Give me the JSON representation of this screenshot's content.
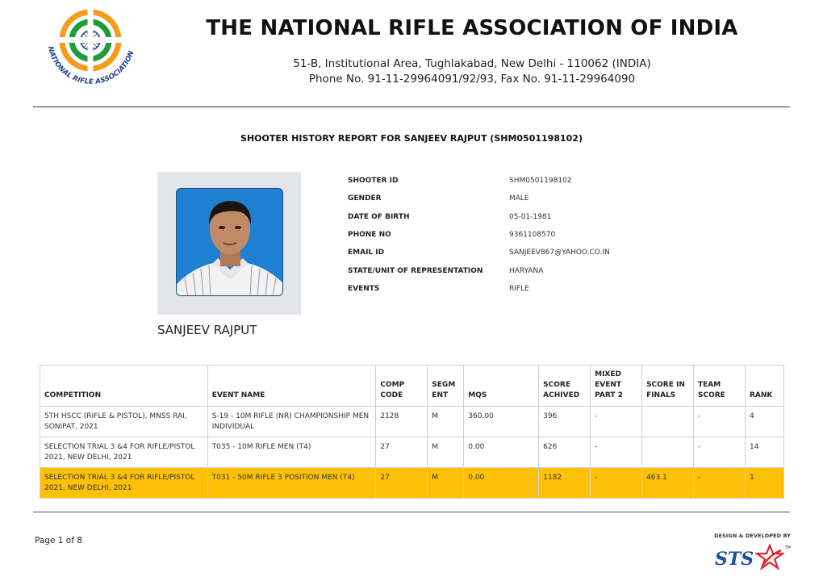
{
  "header": {
    "logo_text": "NATIONAL RIFLE ASSOCIATION OF INDIA",
    "title": "THE NATIONAL RIFLE ASSOCIATION OF INDIA",
    "address": "51-B, Institutional Area, Tughlakabad, New Delhi - 110062 (INDIA)",
    "phone": "Phone No. 91-11-29964091/92/93, Fax No. 91-11-29964090"
  },
  "report_title": "SHOOTER HISTORY REPORT FOR SANJEEV RAJPUT (SHM0501198102)",
  "shooter": {
    "name": "SANJEEV RAJPUT",
    "details": [
      {
        "label": "SHOOTER ID",
        "value": "SHM0501198102"
      },
      {
        "label": "GENDER",
        "value": "MALE"
      },
      {
        "label": "DATE OF BIRTH",
        "value": "05-01-1981"
      },
      {
        "label": "PHONE NO",
        "value": "9361108570"
      },
      {
        "label": "EMAIL ID",
        "value": "SANJEEV867@YAHOO.CO.IN"
      },
      {
        "label": "STATE/UNIT OF REPRESENTATION",
        "value": "HARYANA"
      },
      {
        "label": "EVENTS",
        "value": "RIFLE"
      }
    ]
  },
  "table": {
    "headers": {
      "competition": "COMPETITION",
      "event_name": "EVENT NAME",
      "comp_code": "COMP CODE",
      "segment": "SEGM ENT",
      "mqs": "MQS",
      "score": "SCORE ACHIVED",
      "mixed": "MIXED EVENT PART 2",
      "finals": "SCORE IN FINALS",
      "team": "TEAM SCORE",
      "rank": "RANK"
    },
    "rows": [
      {
        "competition": "5TH HSCC (RIFLE & PISTOL), MNSS RAI, SONIPAT, 2021",
        "event_name": "S-19 - 10M RIFLE (NR) CHAMPIONSHIP MEN INDIVIDUAL",
        "comp_code": "2128",
        "segment": "M",
        "mqs": "360.00",
        "score": "396",
        "mixed": "-",
        "finals": "",
        "team": "-",
        "rank": "4"
      },
      {
        "competition": "SELECTION TRIAL 3 &4 FOR RIFLE/PISTOL 2021, NEW DELHI, 2021",
        "event_name": "T035 - 10M RIFLE MEN (T4)",
        "comp_code": "27",
        "segment": "M",
        "mqs": "0.00",
        "score": "626",
        "mixed": "-",
        "finals": "",
        "team": "-",
        "rank": "14"
      },
      {
        "competition": "SELECTION TRIAL 3 &4 FOR RIFLE/PISTOL 2021, NEW DELHI, 2021",
        "event_name": "T031 - 50M RIFLE 3 POSITION MEN (T4)",
        "comp_code": "27",
        "segment": "M",
        "mqs": "0.00",
        "score": "1182",
        "mixed": "-",
        "finals": "463.1",
        "team": "-",
        "rank": "1"
      }
    ]
  },
  "footer": {
    "page": "Page 1 of 8",
    "credit": "DESIGN & DEVELOPED BY",
    "brand": "STS",
    "trademark": "TM"
  },
  "colors": {
    "highlight_row": "#ffc107",
    "logo_saffron": "#f39c1e",
    "logo_green": "#1e9c3a",
    "logo_chakra": "#1d3f8f",
    "brand_blue": "#1d4f9e",
    "brand_red": "#e0262a"
  }
}
